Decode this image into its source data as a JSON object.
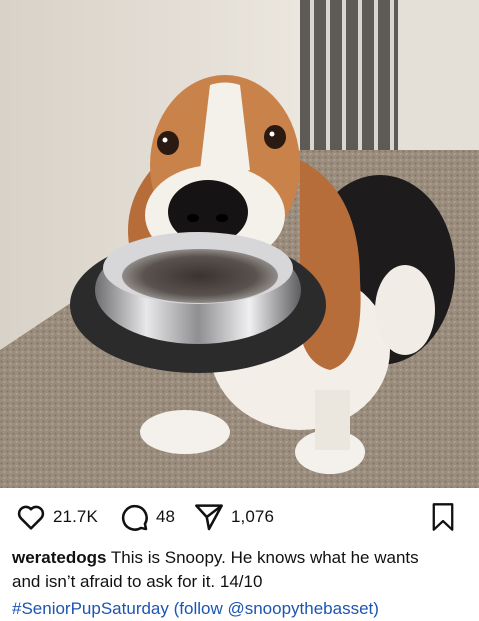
{
  "post": {
    "image_alt": "Basset hound holding a metal food bowl in its mouth",
    "likes": "21.7K",
    "comments": "48",
    "shares": "1,076",
    "username": "weratedogs",
    "caption_line1": "This is Snoopy. He knows what he wants",
    "caption_line2": "and isn’t afraid to ask for it. 14/10",
    "hashtags_partial": "#SeniorPupSaturday (follow @snoopythebasset)"
  },
  "icons": {
    "like": "heart-icon",
    "comment": "comment-bubble-icon",
    "share": "paper-plane-icon",
    "save": "bookmark-icon"
  },
  "colors": {
    "text": "#111111",
    "link": "#1d55b0",
    "background": "#ffffff"
  }
}
